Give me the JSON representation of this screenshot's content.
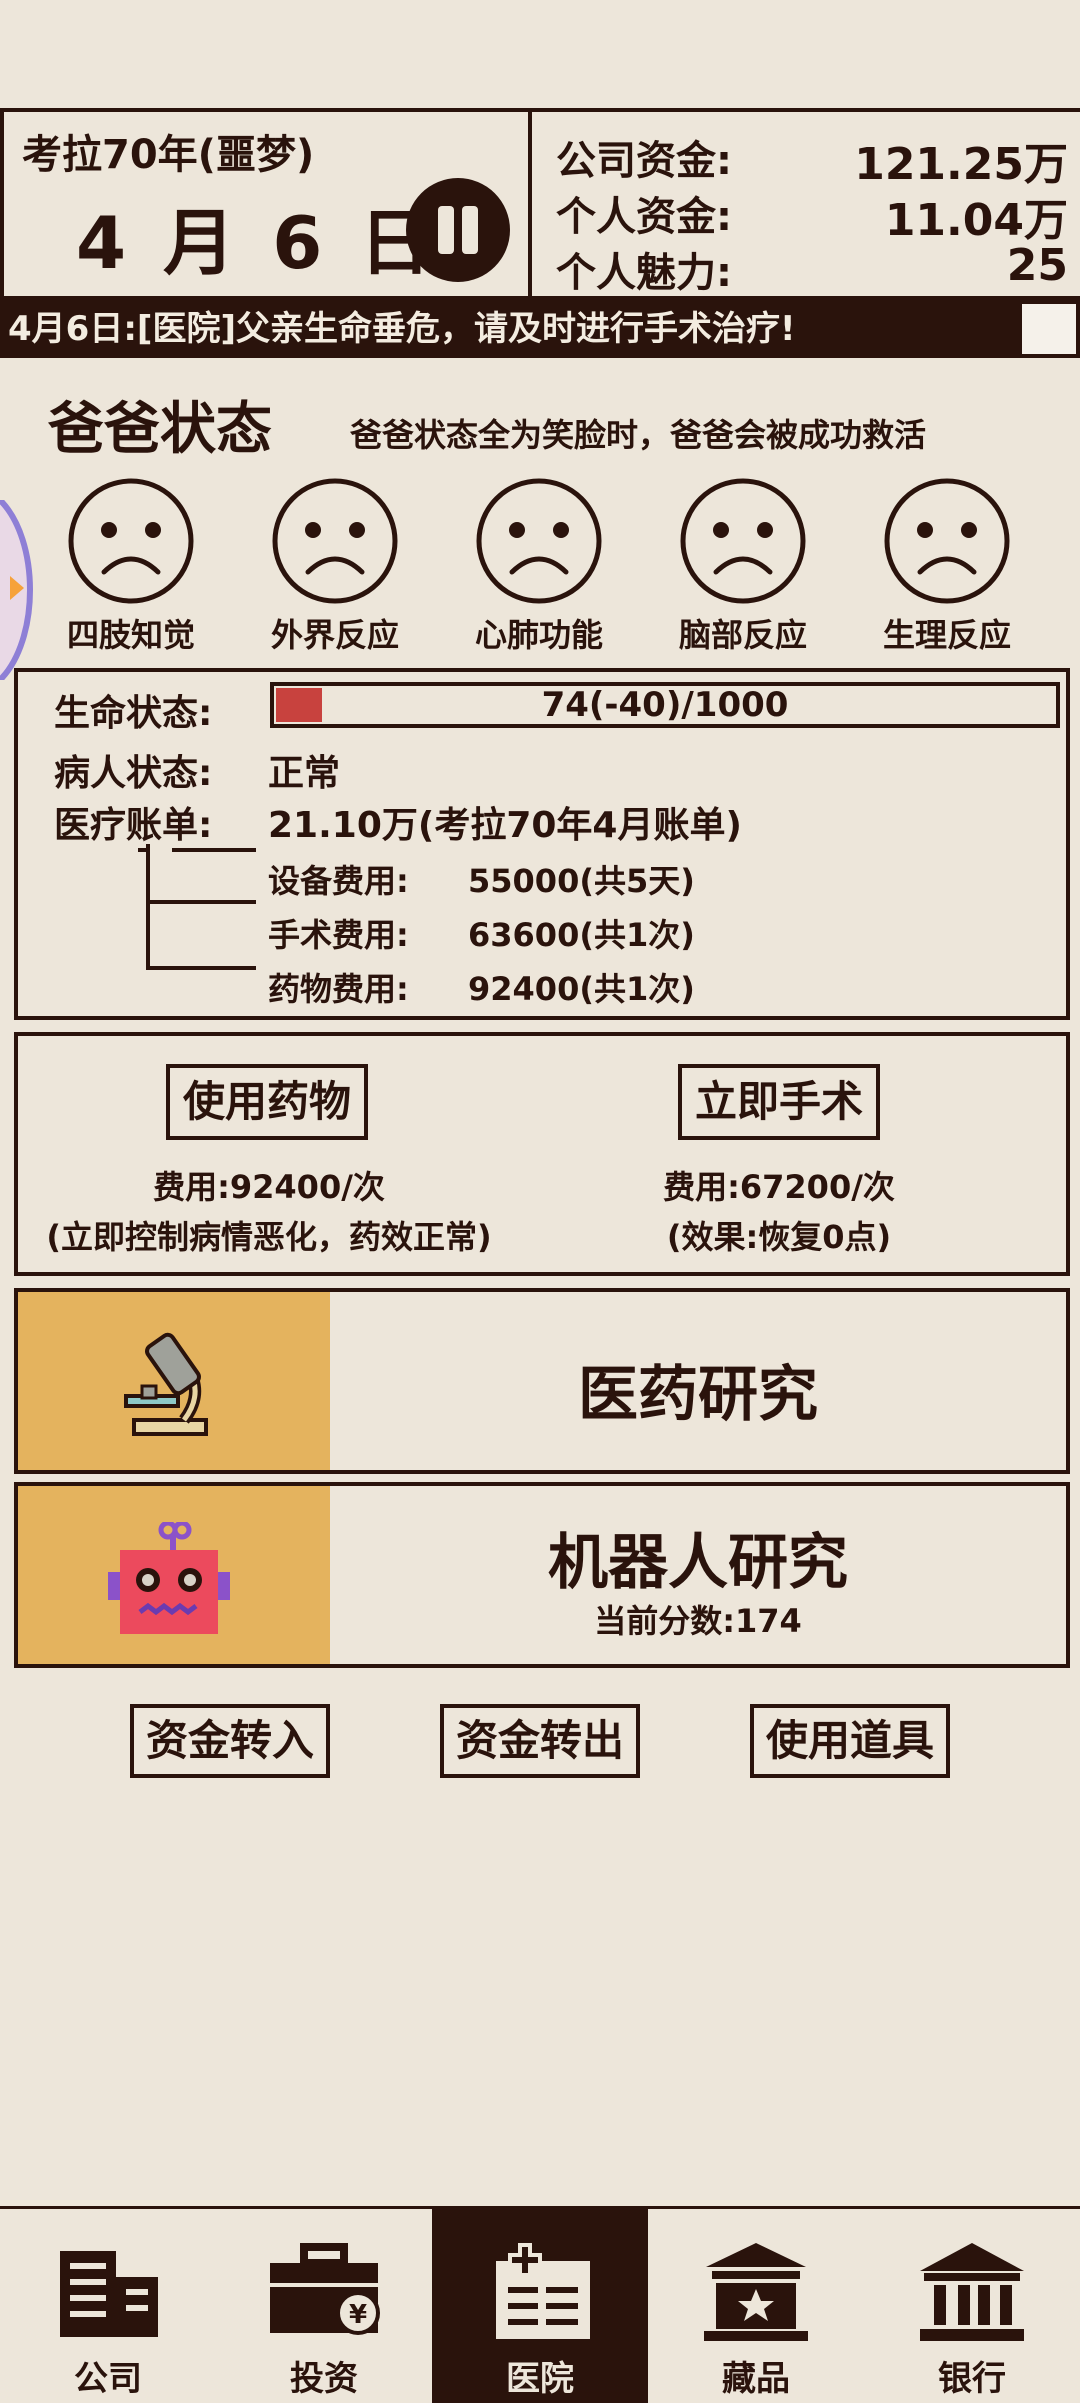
{
  "header": {
    "era": "考拉70年(噩梦)",
    "date": "4 月 6 日",
    "stats": [
      {
        "label": "公司资金:",
        "value": "121.25万"
      },
      {
        "label": "个人资金:",
        "value": "11.04万"
      },
      {
        "label": "个人魅力:",
        "value": "25"
      }
    ]
  },
  "ticker": "4月6日:[医院]父亲生命垂危，请及时进行手术治疗!",
  "dad_status": {
    "title": "爸爸状态",
    "subtitle": "爸爸状态全为笑脸时，爸爸会被成功救活",
    "faces": [
      {
        "label": "四肢知觉",
        "mood": "sad"
      },
      {
        "label": "外界反应",
        "mood": "sad"
      },
      {
        "label": "心肺功能",
        "mood": "sad"
      },
      {
        "label": "脑部反应",
        "mood": "sad"
      },
      {
        "label": "生理反应",
        "mood": "sad"
      }
    ]
  },
  "status": {
    "life_label": "生命状态:",
    "life_text": "74(-40)/1000",
    "life_value": 74,
    "life_max": 1000,
    "patient_label": "病人状态:",
    "patient_value": "正常",
    "bill_label": "医疗账单:",
    "bill_value": "21.10万(考拉70年4月账单)",
    "bills": [
      {
        "label": "设备费用:",
        "amount": "55000(共5天)"
      },
      {
        "label": "手术费用:",
        "amount": "63600(共1次)"
      },
      {
        "label": "药物费用:",
        "amount": "92400(共1次)"
      }
    ]
  },
  "actions": {
    "medicine": {
      "label": "使用药物",
      "cost": "费用:92400/次",
      "note": "(立即控制病情恶化，药效正常)"
    },
    "surgery": {
      "label": "立即手术",
      "cost": "费用:67200/次",
      "note": "(效果:恢复0点)"
    }
  },
  "research": {
    "medical": {
      "title": "医药研究",
      "icon": "microscope-icon"
    },
    "robot": {
      "title": "机器人研究",
      "score": "当前分数:174",
      "icon": "robot-icon"
    }
  },
  "funds": {
    "transfer_in": "资金转入",
    "transfer_out": "资金转出",
    "use_item": "使用道具"
  },
  "nav": [
    {
      "label": "公司",
      "icon": "building-icon"
    },
    {
      "label": "投资",
      "icon": "briefcase-icon"
    },
    {
      "label": "医院",
      "icon": "hospital-icon",
      "active": true
    },
    {
      "label": "藏品",
      "icon": "museum-icon"
    },
    {
      "label": "银行",
      "icon": "bank-icon"
    }
  ],
  "colors": {
    "bg": "#ede6da",
    "ink": "#2a130c",
    "accent": "#e4b35e",
    "health": "#c8423e"
  }
}
